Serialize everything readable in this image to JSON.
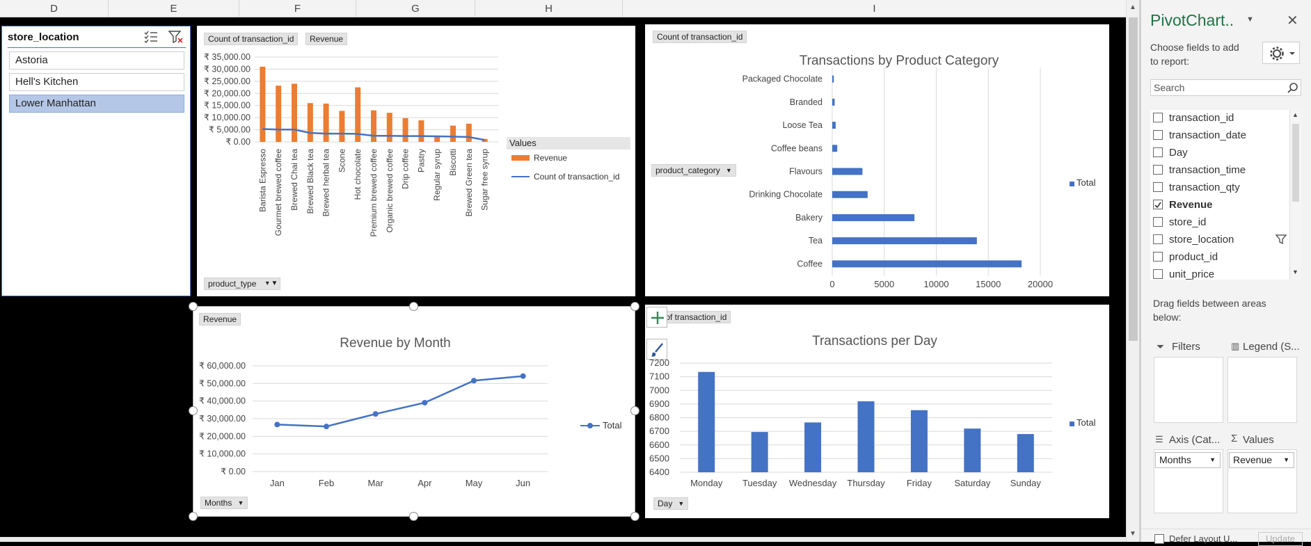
{
  "columns": [
    "D",
    "E",
    "F",
    "G",
    "H",
    "I"
  ],
  "slicer": {
    "title": "store_location",
    "items": [
      "Astoria",
      "Hell's Kitchen",
      "Lower Manhattan"
    ],
    "selected_index": 2
  },
  "product_chart": {
    "field_buttons": {
      "count": "Count of transaction_id",
      "revenue": "Revenue",
      "axis": "product_type"
    },
    "legend_title": "Values",
    "legend_labels": [
      "Revenue",
      "Count of transaction_id"
    ]
  },
  "category_chart": {
    "field_button": "Count of transaction_id",
    "axis_button": "product_category",
    "title": "Transactions by Product Category",
    "legend_label": "Total"
  },
  "month_chart": {
    "field_button": "Revenue",
    "axis_button": "Months",
    "title": "Revenue by Month",
    "legend_label": "Total"
  },
  "day_chart": {
    "field_button": "nt of transaction_id",
    "axis_button": "Day",
    "title": "Transactions per Day",
    "legend_label": "Total"
  },
  "chart_data": [
    {
      "type": "bar",
      "categories": [
        "Barista Espresso",
        "Gourmet brewed coffee",
        "Brewed Chai tea",
        "Brewed Black tea",
        "Brewed herbal tea",
        "Scone",
        "Hot chocolate",
        "Premium brewed coffee",
        "Organic brewed coffee",
        "Drip coffee",
        "Pastry",
        "Regular syrup",
        "Biscotti",
        "Brewed Green tea",
        "Sugar free syrup"
      ],
      "series": [
        {
          "name": "Revenue",
          "type": "bar",
          "color": "#ed7d31",
          "values": [
            31000,
            23200,
            24000,
            16000,
            15800,
            12800,
            22500,
            13000,
            12000,
            9800,
            8900,
            2600,
            6700,
            7500,
            1200
          ]
        },
        {
          "name": "Count of transaction_id",
          "type": "line",
          "color": "#4472c4",
          "values": [
            5300,
            5100,
            5100,
            3700,
            3400,
            3400,
            3300,
            2500,
            2500,
            2400,
            2400,
            2300,
            2200,
            2000,
            800
          ]
        }
      ],
      "ylim": [
        0,
        35000
      ],
      "ytick_labels": [
        "₹ 35,000.00",
        "₹ 30,000.00",
        "₹ 25,000.00",
        "₹ 20,000.00",
        "₹ 15,000.00",
        "₹ 10,000.00",
        "₹ 5,000.00",
        "₹ 0.00"
      ],
      "grid": true,
      "legend": "right"
    },
    {
      "type": "bar",
      "orientation": "horizontal",
      "title": "Transactions by Product Category",
      "categories": [
        "Packaged Chocolate",
        "Branded",
        "Loose Tea",
        "Coffee beans",
        "Flavours",
        "Drinking Chocolate",
        "Bakery",
        "Tea",
        "Coffee"
      ],
      "series": [
        {
          "name": "Total",
          "values": [
            150,
            230,
            330,
            480,
            2900,
            3400,
            7900,
            13900,
            18200
          ],
          "color": "#4472c4"
        }
      ],
      "xlim": [
        0,
        20000
      ],
      "xtick_labels": [
        "0",
        "5000",
        "10000",
        "15000",
        "20000"
      ],
      "grid": true,
      "legend": "right"
    },
    {
      "type": "line",
      "title": "Revenue by Month",
      "categories": [
        "Jan",
        "Feb",
        "Mar",
        "Apr",
        "May",
        "Jun"
      ],
      "series": [
        {
          "name": "Total",
          "values": [
            26700,
            25600,
            32700,
            39100,
            51600,
            54200
          ],
          "color": "#4472c4"
        }
      ],
      "ylim": [
        0,
        60000
      ],
      "ytick_labels": [
        "₹ 60,000.00",
        "₹ 50,000.00",
        "₹ 40,000.00",
        "₹ 30,000.00",
        "₹ 20,000.00",
        "₹ 10,000.00",
        "₹ 0.00"
      ],
      "grid": true,
      "legend": "right"
    },
    {
      "type": "bar",
      "title": "Transactions per Day",
      "categories": [
        "Monday",
        "Tuesday",
        "Wednesday",
        "Thursday",
        "Friday",
        "Saturday",
        "Sunday"
      ],
      "series": [
        {
          "name": "Total",
          "values": [
            7135,
            6695,
            6765,
            6920,
            6855,
            6720,
            6680
          ],
          "color": "#4472c4"
        }
      ],
      "ylim": [
        6400,
        7200
      ],
      "ytick_labels": [
        "7200",
        "7100",
        "7000",
        "6900",
        "6800",
        "6700",
        "6600",
        "6500",
        "6400"
      ],
      "grid": true,
      "legend": "right"
    }
  ],
  "panel": {
    "title": "PivotChart..",
    "subtitle1": "Choose fields to add",
    "subtitle2": "to report:",
    "search_placeholder": "Search",
    "fields": [
      {
        "label": "transaction_id",
        "checked": false
      },
      {
        "label": "transaction_date",
        "checked": false
      },
      {
        "label": "Day",
        "checked": false
      },
      {
        "label": "transaction_time",
        "checked": false
      },
      {
        "label": "transaction_qty",
        "checked": false
      },
      {
        "label": "Revenue",
        "checked": true
      },
      {
        "label": "store_id",
        "checked": false
      },
      {
        "label": "store_location",
        "checked": false,
        "filtered": true
      },
      {
        "label": "product_id",
        "checked": false
      },
      {
        "label": "unit_price",
        "checked": false
      }
    ],
    "drag_text1": "Drag fields between areas",
    "drag_text2": "below:",
    "areas": {
      "filters": "Filters",
      "legend": "Legend (S...",
      "axis": "Axis (Cat...",
      "values": "Values"
    },
    "axis_value": "Months",
    "values_value": "Revenue",
    "defer": "Defer Layout U...",
    "update": "Update"
  },
  "colors": {
    "accent_blue": "#4472c4",
    "accent_orange": "#ed7d31",
    "slicer_selected": "#b4c7e7"
  }
}
